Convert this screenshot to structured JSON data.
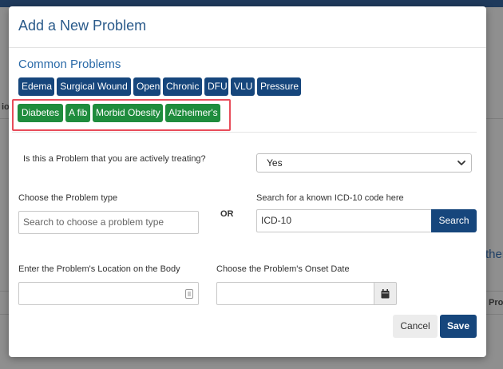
{
  "modal": {
    "title": "Add a New Problem"
  },
  "common_problems": {
    "title": "Common Problems",
    "blue_tags": [
      "Edema",
      "Surgical Wound",
      "Open",
      "Chronic",
      "DFU",
      "VLU",
      "Pressure"
    ],
    "green_tags": [
      "Diabetes",
      "A fib",
      "Morbid Obesity",
      "Alzheimer's"
    ]
  },
  "treating": {
    "question": "Is this a Problem that you are actively treating?",
    "selected": "Yes"
  },
  "problem_type": {
    "label": "Choose the Problem type",
    "placeholder": "Search to choose a problem type"
  },
  "or_label": "OR",
  "icd": {
    "label": "Search for a known ICD-10 code here",
    "value": "ICD-10",
    "search_label": "Search"
  },
  "location": {
    "label": "Enter the Problem's Location on the Body"
  },
  "onset": {
    "label": "Choose the Problem's Onset Date"
  },
  "actions": {
    "cancel_label": "Cancel",
    "save_label": "Save"
  },
  "background": {
    "partial_text_right": "ther",
    "partial_text_right2": "Pro",
    "partial_text_left": "io"
  },
  "colors": {
    "brand_blue": "#16467c",
    "tag_green": "#1f8c3d",
    "highlight_red": "#e84c5a",
    "title_blue": "#2a5a8a"
  },
  "icons": [
    "chevron-down-icon",
    "list-icon",
    "calendar-icon"
  ]
}
